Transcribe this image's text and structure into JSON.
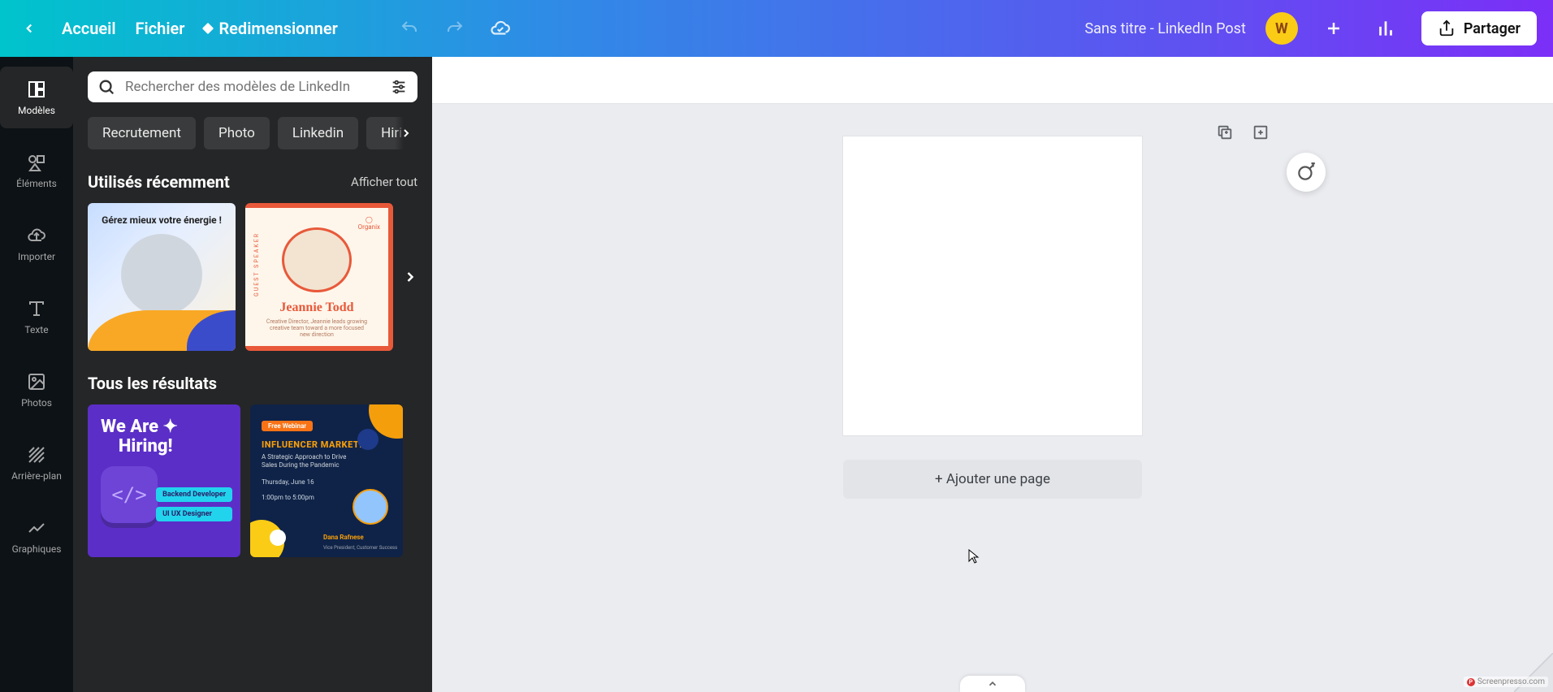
{
  "topbar": {
    "home": "Accueil",
    "file": "Fichier",
    "resize": "Redimensionner",
    "doc_title": "Sans titre - LinkedIn Post",
    "avatar_initial": "W",
    "share": "Partager"
  },
  "rail": {
    "templates": "Modèles",
    "elements": "Éléments",
    "upload": "Importer",
    "text": "Texte",
    "photos": "Photos",
    "background": "Arrière-plan",
    "charts": "Graphiques"
  },
  "panel": {
    "search_placeholder": "Rechercher des modèles de LinkedIn",
    "chips": [
      "Recrutement",
      "Photo",
      "Linkedin",
      "Hiring"
    ],
    "recent": {
      "title": "Utilisés récemment",
      "show_all": "Afficher tout"
    },
    "results": {
      "title": "Tous les résultats"
    },
    "thumb1": {
      "heading": "Gérez mieux votre énergie !"
    },
    "thumb2": {
      "brand": "Organix",
      "side_label": "GUEST SPEAKER",
      "name": "Jeannie Todd",
      "desc": "Creative Director, Jeannie leads growing creative team toward a more focused new direction"
    },
    "result1": {
      "title1": "We Are",
      "title2": "Hiring!",
      "label1": "Backend Developer",
      "label2": "UI UX Designer",
      "code": "</>"
    },
    "result2": {
      "pill": "Free Webinar",
      "heading": "INFLUENCER MARKETING",
      "sub": "A Strategic Approach to Drive Sales During the Pandemic",
      "date": "Thursday, June 16",
      "time": "1:00pm to 5:00pm",
      "name": "Dana Rafnese",
      "role": "Vice President, Customer Success"
    }
  },
  "canvas": {
    "add_page": "+ Ajouter une page"
  },
  "watermark": "Screenpresso.com"
}
